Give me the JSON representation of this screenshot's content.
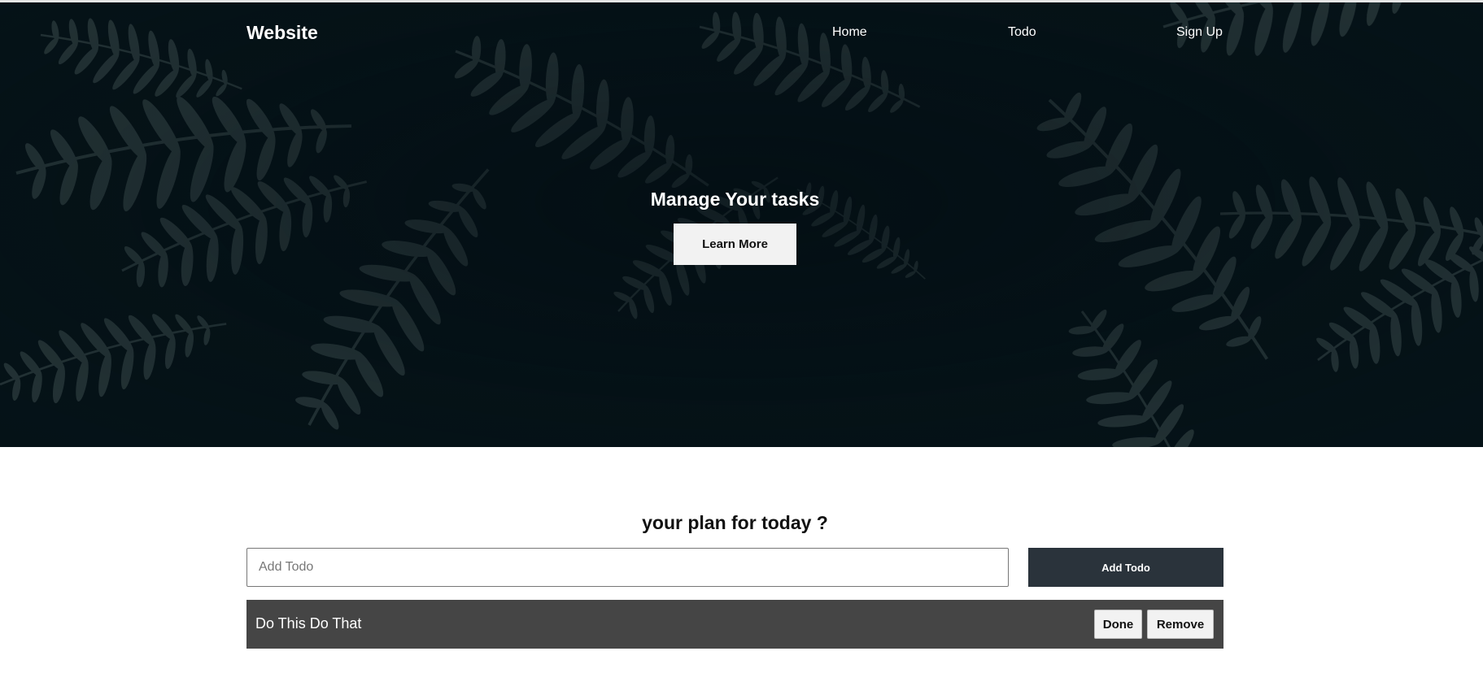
{
  "header": {
    "brand": "Website",
    "nav": [
      "Home",
      "Todo",
      "Sign Up"
    ]
  },
  "hero": {
    "title": "Manage Your tasks",
    "button_label": "Learn More"
  },
  "todo": {
    "heading": "your plan for today ?",
    "input_placeholder": "Add Todo",
    "input_value": "",
    "add_button_label": "Add Todo",
    "items": [
      {
        "text": "Do This Do That",
        "done_label": "Done",
        "remove_label": "Remove"
      }
    ]
  },
  "colors": {
    "hero_background": "#071419",
    "add_button_background": "#2a333b",
    "todo_item_background": "#454545"
  }
}
